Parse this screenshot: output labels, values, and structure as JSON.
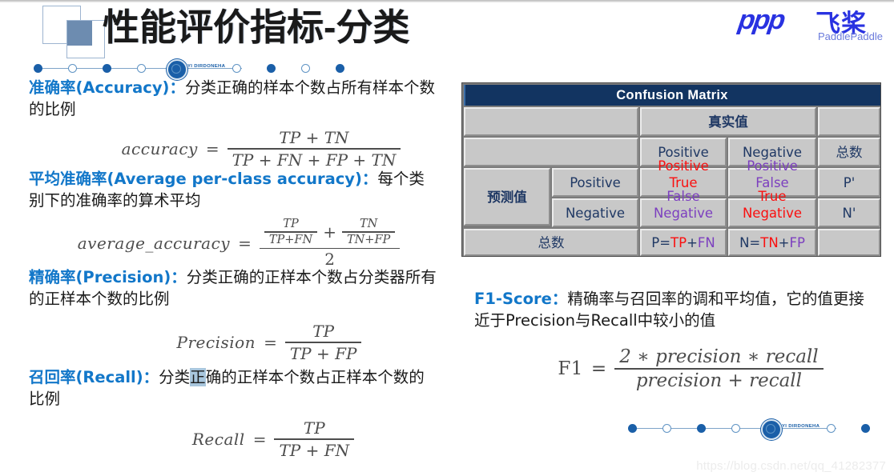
{
  "header": {
    "title": "性能评价指标-分类",
    "logo_mark": "ppp",
    "brand_cn": "飞桨",
    "brand_en": "PaddlePaddle",
    "accent_color": "#2932e1"
  },
  "decor": {
    "badge_text": "YI DIRDONEHA",
    "dot_color": "#1a5fa8",
    "line_color": "#7ea4c8"
  },
  "metrics": [
    {
      "term": "准确率(Accuracy)：",
      "desc": "分类正确的样本个数占所有样本个数的比例",
      "formula": {
        "name": "accuracy",
        "numerator": "TP + TN",
        "denominator": "TP + FN + FP + TN"
      }
    },
    {
      "term": "平均准确率(Average per-class accuracy)：",
      "desc": "每个类别下的准确率的算术平均",
      "formula": {
        "name": "average_accuracy",
        "num_left_num": "TP",
        "num_left_den": "TP+FN",
        "num_plus": "+",
        "num_right_num": "TN",
        "num_right_den": "TN+FP",
        "denominator": "2"
      }
    },
    {
      "term": "精确率(Precision)：",
      "desc": "分类正确的正样本个数占分类器所有的正样本个数的比例",
      "formula": {
        "name": "Precision",
        "numerator": "TP",
        "denominator": "TP + FP"
      }
    },
    {
      "term": "召回率(Recall)：",
      "desc_pre": "分类",
      "desc_highlight": "正",
      "desc_post": "确的正样本个数占正样本个数的比例",
      "formula": {
        "name": "Recall",
        "numerator": "TP",
        "denominator": "TP + FN"
      }
    }
  ],
  "f1": {
    "term": "F1-Score：",
    "desc": "精确率与召回率的调和平均值，它的值更接近于Precision与Recall中较小的值",
    "formula": {
      "name": "F1",
      "numerator": "2 ∗ precision ∗ recall",
      "denominator": "precision + recall"
    }
  },
  "confusion_matrix": {
    "title": "Confusion Matrix",
    "col_group_label": "真实值",
    "row_group_label": "预测值",
    "total_label": "总数",
    "col_headers": [
      "Positive",
      "Negative",
      "总数"
    ],
    "row_headers": [
      "Positive",
      "Negative"
    ],
    "cells": {
      "tp_line1": "True",
      "tp_line2": "Positive",
      "fp_line1": "False",
      "fp_line2": "Positive",
      "fn_line1": "False",
      "fn_line2": "Negative",
      "tn_line1": "True",
      "tn_line2": "Negative",
      "p_prime": "P'",
      "n_prime": "N'",
      "total_p_eq": "P=",
      "total_p_tp": "TP",
      "total_p_plus": "+",
      "total_p_fn": "FN",
      "total_n_eq": "N=",
      "total_n_tn": "TN",
      "total_n_plus": "+",
      "total_n_fp": "FP"
    },
    "colors": {
      "header_bg": "#123461",
      "cell_bg": "#c8c8c8",
      "true_text": "#fa0f0f",
      "false_text": "#7c3fbf",
      "label_text": "#1f3864"
    }
  },
  "watermark": "https://blog.csdn.net/qq_41282377"
}
